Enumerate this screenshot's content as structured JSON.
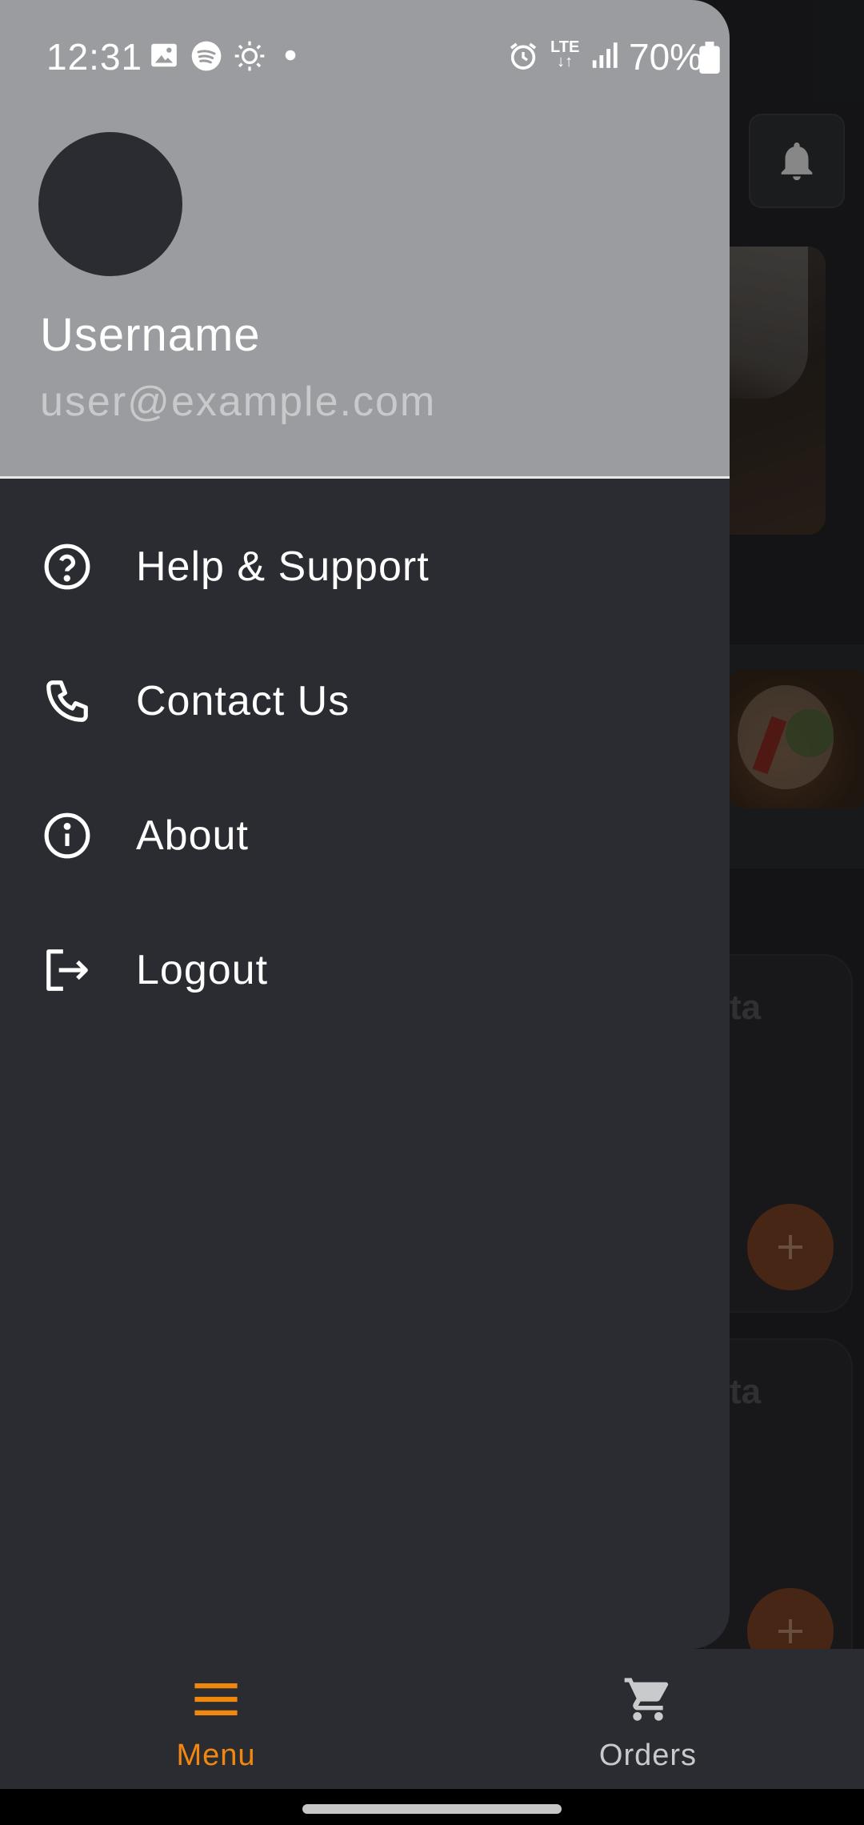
{
  "status_bar": {
    "time": "12:31",
    "network": "LTE",
    "battery": "70%",
    "icons": [
      "gallery-icon",
      "spotify-icon",
      "brightness-icon",
      "dot-icon",
      "alarm-icon",
      "lte-icon",
      "signal-icon",
      "battery-icon"
    ]
  },
  "background": {
    "card_fragment_1": "ta",
    "card_fragment_2": "ta",
    "accent": "#6e3b22"
  },
  "drawer": {
    "username": "Username",
    "email": "user@example.com",
    "items": [
      {
        "label": "Help & Support",
        "icon": "help-circle-icon"
      },
      {
        "label": "Contact Us",
        "icon": "phone-icon"
      },
      {
        "label": "About",
        "icon": "info-circle-icon"
      },
      {
        "label": "Logout",
        "icon": "logout-icon"
      }
    ]
  },
  "bottom_nav": {
    "menu_label": "Menu",
    "orders_label": "Orders",
    "active": "Menu",
    "active_color": "#f0870f",
    "inactive_color": "#c9cacc"
  }
}
